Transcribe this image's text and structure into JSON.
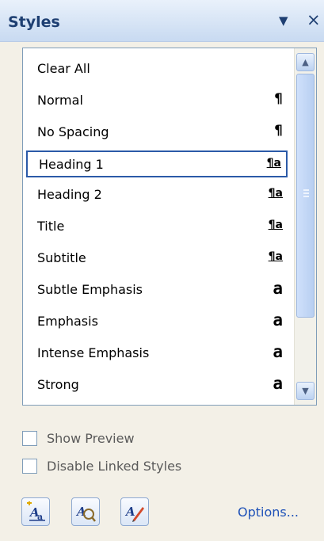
{
  "panel": {
    "title": "Styles"
  },
  "styles_list": [
    {
      "label": "Clear All",
      "icon": "none"
    },
    {
      "label": "Normal",
      "icon": "pilcrow-icon",
      "glyph": "¶"
    },
    {
      "label": "No Spacing",
      "icon": "pilcrow-icon",
      "glyph": "¶"
    },
    {
      "label": "Heading 1",
      "icon": "linked-style-icon",
      "glyph": "¶a",
      "selected": true
    },
    {
      "label": "Heading 2",
      "icon": "linked-style-icon",
      "glyph": "¶a"
    },
    {
      "label": "Title",
      "icon": "linked-style-icon",
      "glyph": "¶a"
    },
    {
      "label": "Subtitle",
      "icon": "linked-style-icon",
      "glyph": "¶a"
    },
    {
      "label": "Subtle Emphasis",
      "icon": "character-style-icon",
      "glyph": "a"
    },
    {
      "label": "Emphasis",
      "icon": "character-style-icon",
      "glyph": "a"
    },
    {
      "label": "Intense Emphasis",
      "icon": "character-style-icon",
      "glyph": "a"
    },
    {
      "label": "Strong",
      "icon": "character-style-icon",
      "glyph": "a"
    }
  ],
  "options": {
    "show_preview": {
      "label": "Show Preview",
      "checked": false
    },
    "disable_linked_styles": {
      "label": "Disable Linked Styles",
      "checked": false
    }
  },
  "footer": {
    "options_link": "Options..."
  },
  "colors": {
    "title": "#1e3f72",
    "selection_border": "#2b5aa8",
    "link": "#1f52b8"
  }
}
